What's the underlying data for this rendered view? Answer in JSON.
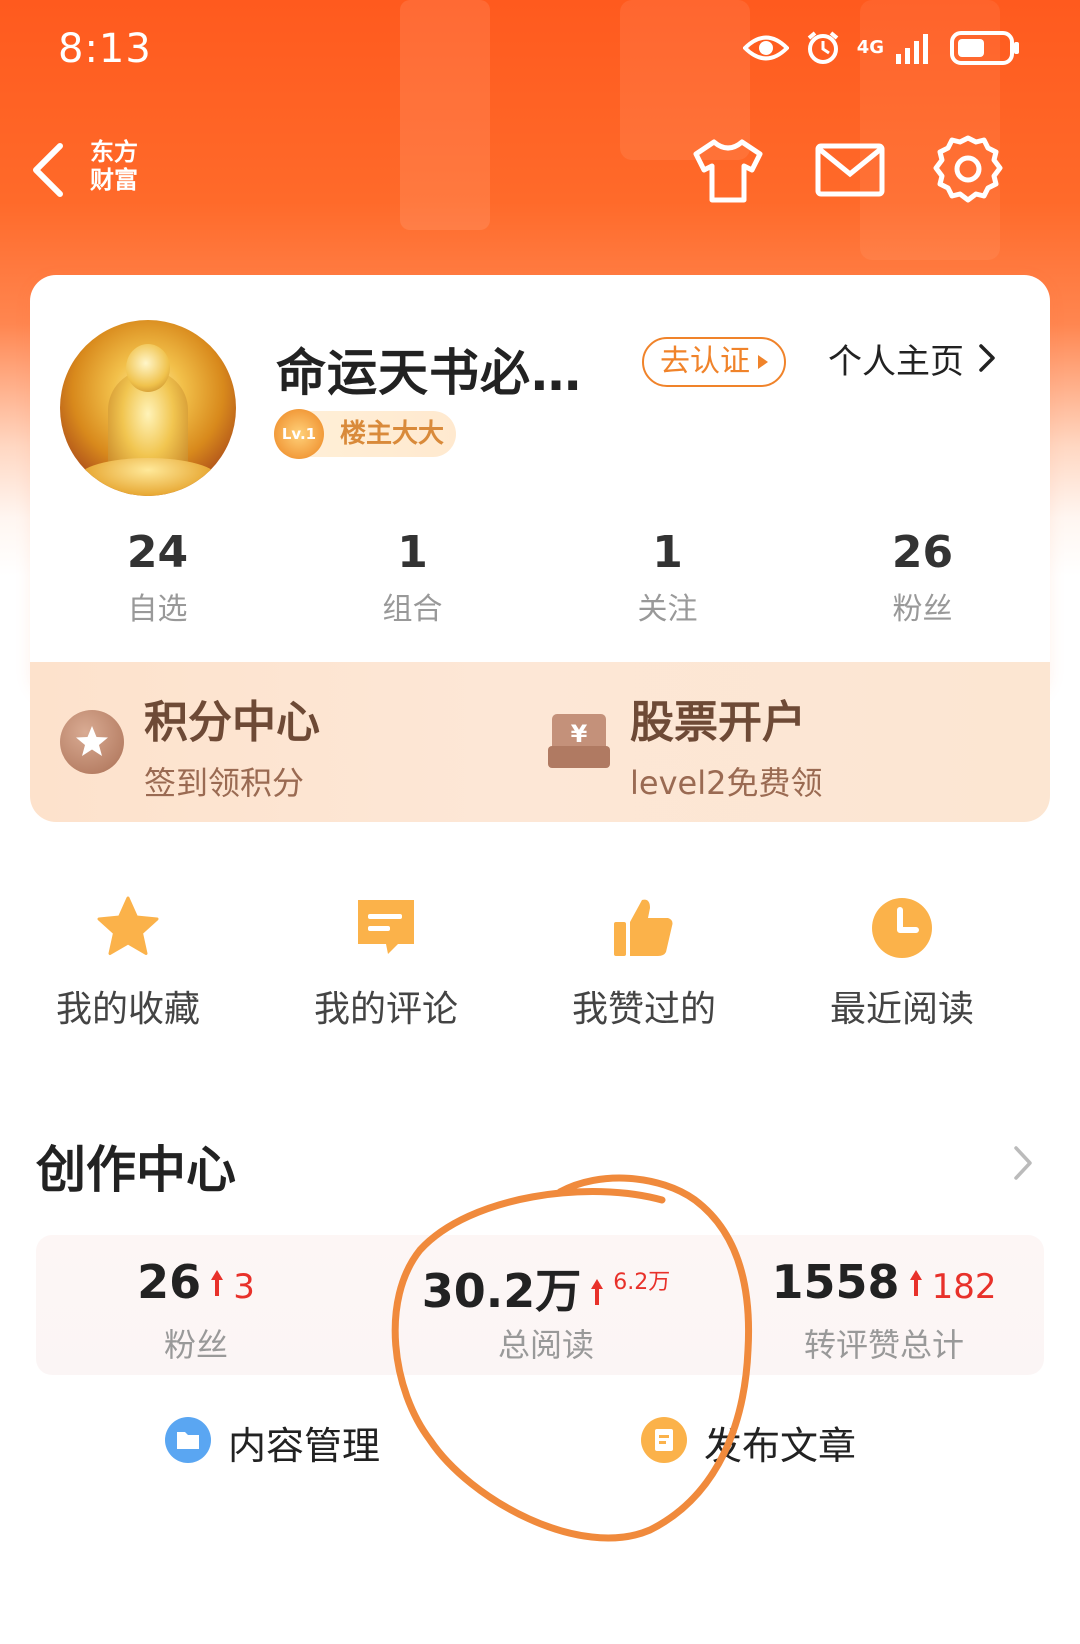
{
  "status_bar": {
    "time": "8:13",
    "network": "4G"
  },
  "nav": {
    "back_label_line1": "东方",
    "back_label_line2": "财富",
    "icons": [
      "back-chevron-icon",
      "tshirt-icon",
      "mail-icon",
      "gear-icon"
    ]
  },
  "profile": {
    "username": "命运天书必…",
    "verify_label": "去认证",
    "homepage_label": "个人主页",
    "level_label": "Lv.1",
    "level_title": "楼主大大",
    "stats": [
      {
        "value": "24",
        "label": "自选"
      },
      {
        "value": "1",
        "label": "组合"
      },
      {
        "value": "1",
        "label": "关注"
      },
      {
        "value": "26",
        "label": "粉丝"
      }
    ]
  },
  "promos": {
    "points": {
      "title": "积分中心",
      "subtitle": "签到领积分",
      "icon": "star-badge-icon"
    },
    "account": {
      "title": "股票开户",
      "subtitle": "level2免费领",
      "icon": "yen-wallet-icon"
    }
  },
  "shortcuts": [
    {
      "label": "我的收藏",
      "icon": "star-icon"
    },
    {
      "label": "我的评论",
      "icon": "comment-icon"
    },
    {
      "label": "我赞过的",
      "icon": "thumbs-up-icon"
    },
    {
      "label": "最近阅读",
      "icon": "clock-icon"
    }
  ],
  "creator_center": {
    "title": "创作中心",
    "stats": [
      {
        "value": "26",
        "delta": "3",
        "label": "粉丝"
      },
      {
        "value": "30.2万",
        "delta": "6.2万",
        "label": "总阅读"
      },
      {
        "value": "1558",
        "delta": "182",
        "label": "转评赞总计"
      }
    ],
    "actions": [
      {
        "label": "内容管理",
        "icon": "folder-icon"
      },
      {
        "label": "发布文章",
        "icon": "publish-icon"
      }
    ]
  },
  "colors": {
    "brand_orange": "#ff5a1e",
    "accent_orange": "#f0832a",
    "increase_red": "#e8312a",
    "annotation_orange": "#f08a3c"
  }
}
